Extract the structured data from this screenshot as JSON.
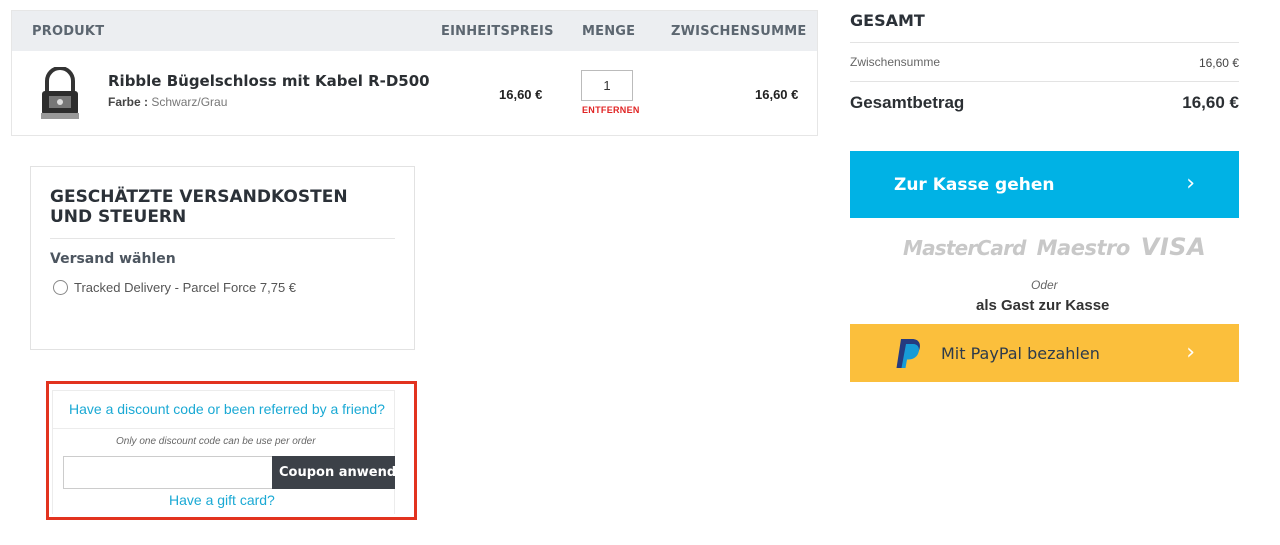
{
  "cart": {
    "headers": {
      "product": "PRODUKT",
      "unit_price": "EINHEITSPREIS",
      "quantity": "MENGE",
      "subtotal": "ZWISCHENSUMME"
    },
    "item": {
      "name": "Ribble Bügelschloss mit Kabel R-D500",
      "attr_label": "Farbe :",
      "attr_value": "Schwarz/Grau",
      "unit_price": "16,60 €",
      "quantity": "1",
      "remove_label": "ENTFERNEN",
      "line_subtotal": "16,60 €"
    }
  },
  "shipping": {
    "title": "GESCHÄTZTE VERSANDKOSTEN UND STEUERN",
    "subtitle": "Versand wählen",
    "option": "Tracked Delivery - Parcel Force 7,75 €"
  },
  "discount": {
    "question": "Have a discount code or been referred by a friend?",
    "note": "Only one discount code can be use per order",
    "input_placeholder": "",
    "apply_label": "Coupon anwenden",
    "gift_card": "Have a gift card?"
  },
  "totals": {
    "title": "GESAMT",
    "subtotal_label": "Zwischensumme",
    "subtotal_value": "16,60 €",
    "grand_label": "Gesamtbetrag",
    "grand_value": "16,60 €"
  },
  "checkout": {
    "label": "Zur Kasse gehen",
    "chevron": "›"
  },
  "payment_logos": [
    "MasterCard",
    "Maestro",
    "VISA"
  ],
  "guest": {
    "or": "Oder",
    "label": "als Gast zur Kasse"
  },
  "paypal": {
    "label": "Mit PayPal bezahlen",
    "chevron": "›"
  },
  "colors": {
    "accent_blue": "#00b2e5",
    "paypal_yellow": "#fbbf3c",
    "remove_red": "#e02424",
    "highlight_red": "#e2331f",
    "link_cyan": "#1aa9d4"
  }
}
